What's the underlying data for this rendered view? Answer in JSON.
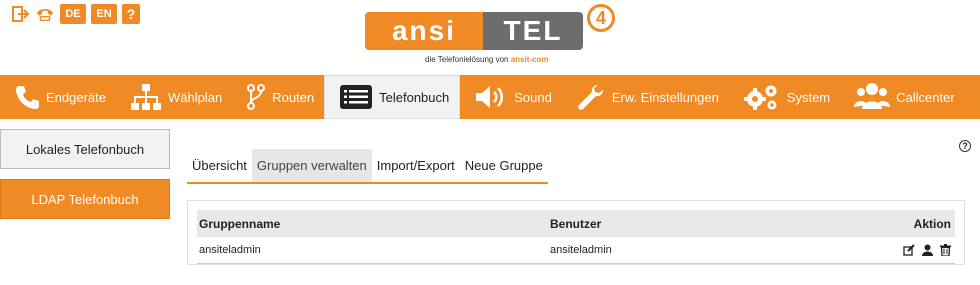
{
  "topbar": {
    "icons": [
      "logout-icon",
      "phone-hangup-icon"
    ],
    "lang_de": "DE",
    "lang_en": "EN",
    "help": "?"
  },
  "logo": {
    "left": "ansi",
    "right": "TEL",
    "version": "4",
    "tagline_prefix": "die Telefonielösung von",
    "tagline_brand": "ansit-com"
  },
  "nav": {
    "items": [
      {
        "label": "Endgeräte",
        "icon": "phone-icon"
      },
      {
        "label": "Wählplan",
        "icon": "sitemap-icon"
      },
      {
        "label": "Routen",
        "icon": "route-icon"
      },
      {
        "label": "Telefonbuch",
        "icon": "list-icon",
        "active": true
      },
      {
        "label": "Sound",
        "icon": "speaker-icon"
      },
      {
        "label": "Erw. Einstellungen",
        "icon": "wrench-icon"
      },
      {
        "label": "System",
        "icon": "gears-icon"
      },
      {
        "label": "Callcenter",
        "icon": "users-icon"
      }
    ]
  },
  "sidebar": {
    "items": [
      {
        "label": "Lokales Telefonbuch"
      },
      {
        "label": "LDAP Telefonbuch"
      }
    ]
  },
  "help_label": "?",
  "subtabs": [
    {
      "label": "Übersicht"
    },
    {
      "label": "Gruppen verwalten",
      "active": true
    },
    {
      "label": "Import/Export"
    },
    {
      "label": "Neue Gruppe"
    }
  ],
  "table": {
    "headers": {
      "name": "Gruppenname",
      "user": "Benutzer",
      "action": "Aktion"
    },
    "rows": [
      {
        "name": "ansiteladmin",
        "user": "ansiteladmin",
        "actions": [
          "edit-icon",
          "user-icon",
          "trash-icon"
        ]
      }
    ]
  },
  "colors": {
    "accent": "#f08a24",
    "logo_gray": "#6d6d6d"
  }
}
